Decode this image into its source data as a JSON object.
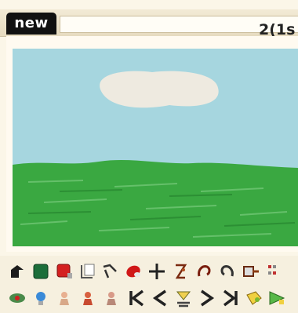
{
  "header": {
    "new_label": "new",
    "page_indicator": "2(1s"
  },
  "toolbar": {
    "row1": [
      "pen-icon",
      "color-green-icon",
      "color-red-icon",
      "page-icon",
      "brush-icon",
      "eraser-icon",
      "crosshair-icon",
      "spray-icon",
      "undo-icon",
      "redo-icon",
      "export-icon",
      "grid-icon"
    ],
    "row2": [
      "view-icon",
      "bulb-icon",
      "pawn-light-icon",
      "pawn-red-icon",
      "pawn-gray-icon",
      "first-frame-icon",
      "prev-frame-icon",
      "play-icon",
      "next-frame-icon",
      "last-frame-icon",
      "add-frame-icon",
      "send-icon"
    ]
  },
  "colors": {
    "sky": "#a6d6df",
    "grass": "#3aa841",
    "cloud": "#eeeae0",
    "bar_dark": "#111111"
  }
}
